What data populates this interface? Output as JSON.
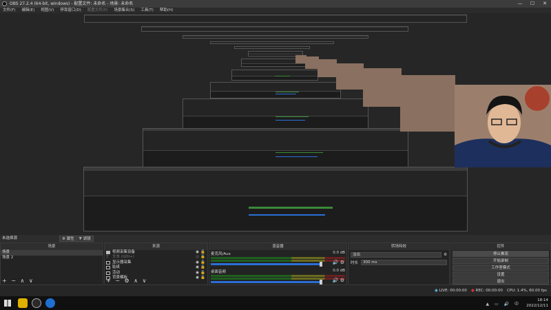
{
  "window": {
    "title": "OBS 27.2.4 (64-bit, windows) - 配置文件: 未命名 - 场景: 未命名",
    "minimize": "—",
    "maximize": "☐",
    "close": "✕"
  },
  "menu": {
    "items": [
      {
        "label": "文件(F)",
        "enabled": true
      },
      {
        "label": "编辑(E)",
        "enabled": true
      },
      {
        "label": "视图(V)",
        "enabled": true
      },
      {
        "label": "停靠窗口(D)",
        "enabled": true
      },
      {
        "label": "配置文件(P)",
        "enabled": false
      },
      {
        "label": "场景集合(S)",
        "enabled": true
      },
      {
        "label": "工具(T)",
        "enabled": true
      },
      {
        "label": "帮助(H)",
        "enabled": true
      }
    ]
  },
  "scene_bar": {
    "scene_label": "未选择源",
    "properties_label": "属性",
    "filters_label": "滤镜"
  },
  "scenes": {
    "header": "场景",
    "items": [
      "场景",
      "场景 2"
    ],
    "footer": "+ − ∧ ∨"
  },
  "sources": {
    "header": "来源",
    "items": [
      {
        "label": "视频采集设备",
        "icon": "camera-icon",
        "visible": true
      },
      {
        "label": "文本 (GDI+)",
        "icon": "text-icon",
        "visible": false
      },
      {
        "label": "显示器采集",
        "icon": "monitor-icon",
        "visible": true
      },
      {
        "label": "贴纸",
        "icon": "image-icon",
        "visible": true
      },
      {
        "label": "活动",
        "icon": "image-icon",
        "visible": true
      },
      {
        "label": "背景模板",
        "icon": "image-icon",
        "visible": true
      }
    ],
    "footer": "+ − ⚙ ∧ ∨"
  },
  "mixer": {
    "header": "混音器",
    "tracks": [
      {
        "name": "麦克风/Aux",
        "db": "0.0 dB"
      },
      {
        "name": "桌面音频",
        "db": "0.0 dB"
      }
    ]
  },
  "transitions": {
    "header": "转场特效",
    "selected": "淡出",
    "duration_label": "时长",
    "duration_value": "300 ms"
  },
  "controls": {
    "header": "控件",
    "buttons": [
      "停止推流",
      "开始录制",
      "工作室模式",
      "设置",
      "退出"
    ]
  },
  "status": {
    "live": "LIVE: 00:00:00",
    "rec": "REC: 00:00:00",
    "cpu": "CPU: 1.4%, 60.00 fps"
  },
  "taskbar": {
    "time": "18:14",
    "date": "2022/12/11"
  },
  "colors": {
    "accent": "#2a6fd6",
    "meter_green": "#1f5f1f",
    "rec_red": "#cc3333"
  }
}
